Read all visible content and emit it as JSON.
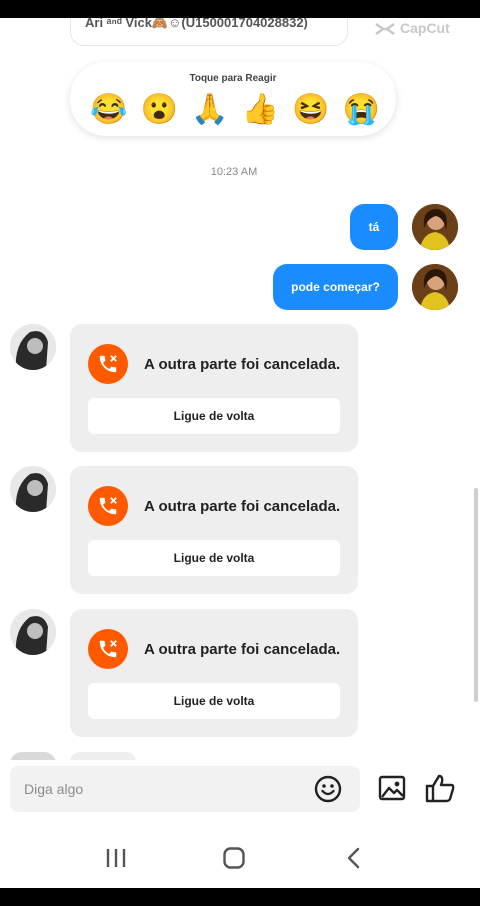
{
  "header": {
    "contact_label": "Ari ᵃⁿᵈ Vick🙈☺(U150001704028832)",
    "watermark": "CapCut"
  },
  "reactions": {
    "title": "Toque para Reagir",
    "emojis": [
      "😂",
      "😮",
      "🙏",
      "👍",
      "😆",
      "😭"
    ]
  },
  "chat": {
    "timestamp": "10:23 AM",
    "sent": [
      {
        "text": "tá"
      },
      {
        "text": "pode começar?"
      }
    ],
    "calls": [
      {
        "status": "A outra parte foi cancelada.",
        "button": "Ligue de volta"
      },
      {
        "status": "A outra parte foi cancelada.",
        "button": "Ligue de volta"
      },
      {
        "status": "A outra parte foi cancelada.",
        "button": "Ligue de volta"
      }
    ]
  },
  "composer": {
    "placeholder": "Diga algo"
  },
  "icons": {
    "emoji": "smile-icon",
    "image": "image-icon",
    "like": "thumbs-up-icon",
    "call": "missed-call-icon",
    "nav_recent": "recent-apps-icon",
    "nav_home": "home-icon",
    "nav_back": "back-icon"
  },
  "colors": {
    "bubble": "#1a8cff",
    "call_icon": "#ff5a00",
    "card": "#eeeeee"
  }
}
